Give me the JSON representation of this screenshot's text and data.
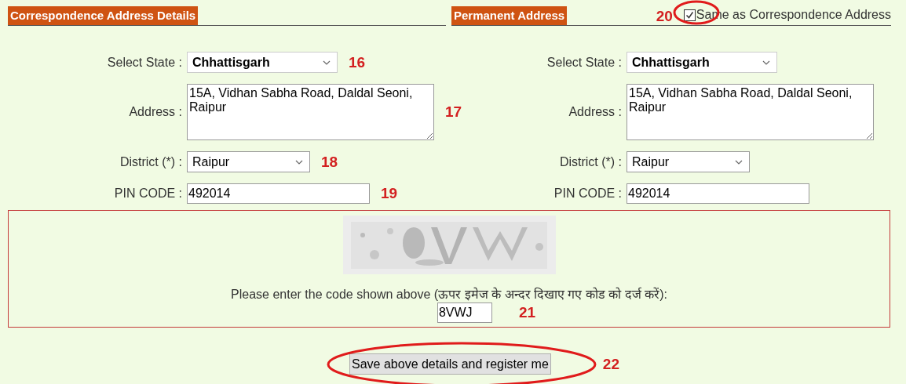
{
  "correspondence": {
    "title": "Correspondence Address Details",
    "fields": [
      {
        "kind": "select",
        "label": "Select State :",
        "value": "Chhattisgarh",
        "bold": true,
        "annotation": "16"
      },
      {
        "kind": "textarea",
        "label": "Address :",
        "value": "15A, Vidhan Sabha Road, Daldal Seoni, Raipur",
        "annotation": "17"
      },
      {
        "kind": "select",
        "label": "District (*) :",
        "value": "Raipur",
        "bold": false,
        "annotation": "18"
      },
      {
        "kind": "text",
        "label": "PIN CODE :",
        "value": "492014",
        "annotation": "19"
      }
    ]
  },
  "permanent": {
    "title": "Permanent Address",
    "annotation": "20",
    "same_as": {
      "label": "Same as Correspondence Address",
      "checked": true,
      "circled": true
    },
    "fields": [
      {
        "kind": "select",
        "label": "Select State :",
        "value": "Chhattisgarh",
        "bold": true
      },
      {
        "kind": "textarea",
        "label": "Address :",
        "value": "15A, Vidhan Sabha Road, Daldal Seoni, Raipur"
      },
      {
        "kind": "select",
        "label": "District (*) :",
        "value": "Raipur",
        "bold": false
      },
      {
        "kind": "text",
        "label": "PIN CODE :",
        "value": "492014"
      }
    ]
  },
  "captcha": {
    "prompt": "Please enter the code shown above (ऊपर इमेज के अन्दर दिखाए गए कोड को दर्ज करें):",
    "value": "8VWJ",
    "annotation": "21"
  },
  "submit": {
    "label": "Save above details and register me",
    "annotation": "22",
    "circled": true
  }
}
